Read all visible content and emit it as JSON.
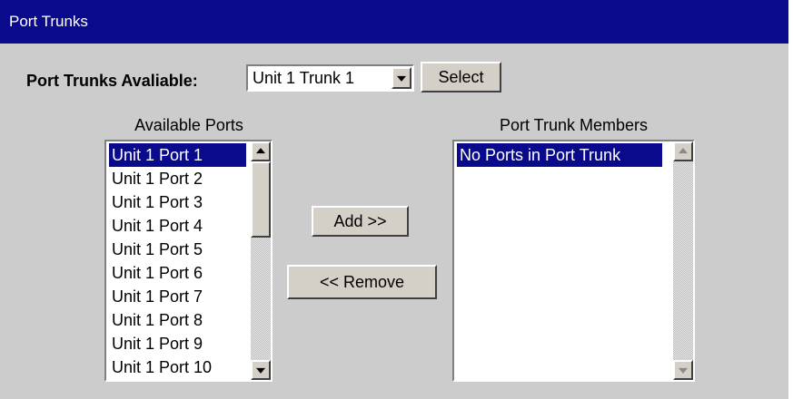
{
  "window": {
    "title": "Port Trunks"
  },
  "trunk_selector": {
    "label": "Port Trunks Avaliable:",
    "selected": "Unit 1 Trunk 1",
    "select_button": "Select"
  },
  "available_ports": {
    "caption": "Available Ports",
    "items": [
      "Unit 1 Port 1",
      "Unit 1 Port 2",
      "Unit 1 Port 3",
      "Unit 1 Port 4",
      "Unit 1 Port 5",
      "Unit 1 Port 6",
      "Unit 1 Port 7",
      "Unit 1 Port 8",
      "Unit 1 Port 9",
      "Unit 1 Port 10"
    ],
    "selected_index": 0
  },
  "actions": {
    "add_label": "Add >>",
    "remove_label": "<< Remove"
  },
  "trunk_members": {
    "caption": "Port Trunk Members",
    "items": [
      "No Ports in Port Trunk"
    ],
    "selected_index": 0
  },
  "colors": {
    "title_bar": "#0a0a8c",
    "panel_background": "#cccccc",
    "selection": "#0a0a8c"
  },
  "icons": {
    "dropdown": "chevron-down-icon",
    "scroll_up": "scroll-up-arrow-icon",
    "scroll_down": "scroll-down-arrow-icon"
  }
}
